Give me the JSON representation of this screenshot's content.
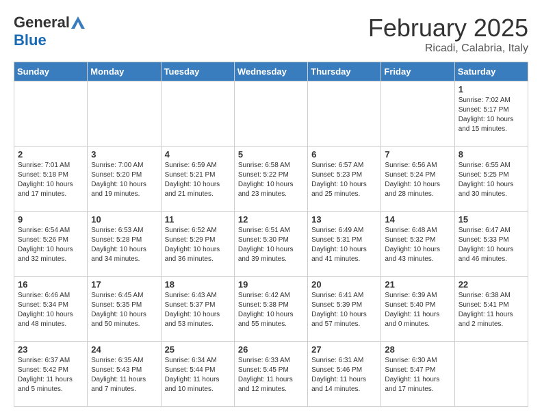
{
  "header": {
    "logo_general": "General",
    "logo_blue": "Blue",
    "month_title": "February 2025",
    "subtitle": "Ricadi, Calabria, Italy"
  },
  "weekdays": [
    "Sunday",
    "Monday",
    "Tuesday",
    "Wednesday",
    "Thursday",
    "Friday",
    "Saturday"
  ],
  "weeks": [
    [
      {
        "day": "",
        "info": ""
      },
      {
        "day": "",
        "info": ""
      },
      {
        "day": "",
        "info": ""
      },
      {
        "day": "",
        "info": ""
      },
      {
        "day": "",
        "info": ""
      },
      {
        "day": "",
        "info": ""
      },
      {
        "day": "1",
        "info": "Sunrise: 7:02 AM\nSunset: 5:17 PM\nDaylight: 10 hours\nand 15 minutes."
      }
    ],
    [
      {
        "day": "2",
        "info": "Sunrise: 7:01 AM\nSunset: 5:18 PM\nDaylight: 10 hours\nand 17 minutes."
      },
      {
        "day": "3",
        "info": "Sunrise: 7:00 AM\nSunset: 5:20 PM\nDaylight: 10 hours\nand 19 minutes."
      },
      {
        "day": "4",
        "info": "Sunrise: 6:59 AM\nSunset: 5:21 PM\nDaylight: 10 hours\nand 21 minutes."
      },
      {
        "day": "5",
        "info": "Sunrise: 6:58 AM\nSunset: 5:22 PM\nDaylight: 10 hours\nand 23 minutes."
      },
      {
        "day": "6",
        "info": "Sunrise: 6:57 AM\nSunset: 5:23 PM\nDaylight: 10 hours\nand 25 minutes."
      },
      {
        "day": "7",
        "info": "Sunrise: 6:56 AM\nSunset: 5:24 PM\nDaylight: 10 hours\nand 28 minutes."
      },
      {
        "day": "8",
        "info": "Sunrise: 6:55 AM\nSunset: 5:25 PM\nDaylight: 10 hours\nand 30 minutes."
      }
    ],
    [
      {
        "day": "9",
        "info": "Sunrise: 6:54 AM\nSunset: 5:26 PM\nDaylight: 10 hours\nand 32 minutes."
      },
      {
        "day": "10",
        "info": "Sunrise: 6:53 AM\nSunset: 5:28 PM\nDaylight: 10 hours\nand 34 minutes."
      },
      {
        "day": "11",
        "info": "Sunrise: 6:52 AM\nSunset: 5:29 PM\nDaylight: 10 hours\nand 36 minutes."
      },
      {
        "day": "12",
        "info": "Sunrise: 6:51 AM\nSunset: 5:30 PM\nDaylight: 10 hours\nand 39 minutes."
      },
      {
        "day": "13",
        "info": "Sunrise: 6:49 AM\nSunset: 5:31 PM\nDaylight: 10 hours\nand 41 minutes."
      },
      {
        "day": "14",
        "info": "Sunrise: 6:48 AM\nSunset: 5:32 PM\nDaylight: 10 hours\nand 43 minutes."
      },
      {
        "day": "15",
        "info": "Sunrise: 6:47 AM\nSunset: 5:33 PM\nDaylight: 10 hours\nand 46 minutes."
      }
    ],
    [
      {
        "day": "16",
        "info": "Sunrise: 6:46 AM\nSunset: 5:34 PM\nDaylight: 10 hours\nand 48 minutes."
      },
      {
        "day": "17",
        "info": "Sunrise: 6:45 AM\nSunset: 5:35 PM\nDaylight: 10 hours\nand 50 minutes."
      },
      {
        "day": "18",
        "info": "Sunrise: 6:43 AM\nSunset: 5:37 PM\nDaylight: 10 hours\nand 53 minutes."
      },
      {
        "day": "19",
        "info": "Sunrise: 6:42 AM\nSunset: 5:38 PM\nDaylight: 10 hours\nand 55 minutes."
      },
      {
        "day": "20",
        "info": "Sunrise: 6:41 AM\nSunset: 5:39 PM\nDaylight: 10 hours\nand 57 minutes."
      },
      {
        "day": "21",
        "info": "Sunrise: 6:39 AM\nSunset: 5:40 PM\nDaylight: 11 hours\nand 0 minutes."
      },
      {
        "day": "22",
        "info": "Sunrise: 6:38 AM\nSunset: 5:41 PM\nDaylight: 11 hours\nand 2 minutes."
      }
    ],
    [
      {
        "day": "23",
        "info": "Sunrise: 6:37 AM\nSunset: 5:42 PM\nDaylight: 11 hours\nand 5 minutes."
      },
      {
        "day": "24",
        "info": "Sunrise: 6:35 AM\nSunset: 5:43 PM\nDaylight: 11 hours\nand 7 minutes."
      },
      {
        "day": "25",
        "info": "Sunrise: 6:34 AM\nSunset: 5:44 PM\nDaylight: 11 hours\nand 10 minutes."
      },
      {
        "day": "26",
        "info": "Sunrise: 6:33 AM\nSunset: 5:45 PM\nDaylight: 11 hours\nand 12 minutes."
      },
      {
        "day": "27",
        "info": "Sunrise: 6:31 AM\nSunset: 5:46 PM\nDaylight: 11 hours\nand 14 minutes."
      },
      {
        "day": "28",
        "info": "Sunrise: 6:30 AM\nSunset: 5:47 PM\nDaylight: 11 hours\nand 17 minutes."
      },
      {
        "day": "",
        "info": ""
      }
    ]
  ]
}
